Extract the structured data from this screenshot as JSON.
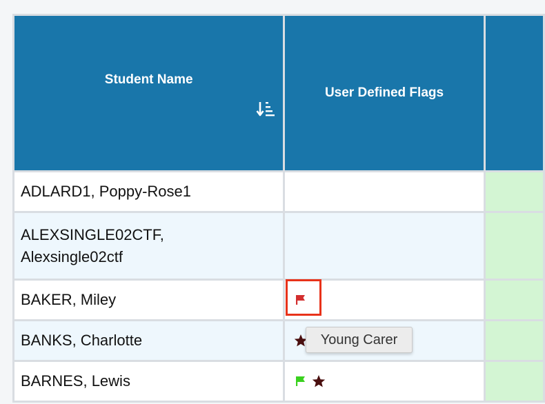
{
  "table": {
    "headers": {
      "student_name": "Student Name",
      "user_defined_flags": "User Defined Flags"
    },
    "rows": [
      {
        "name": "ADLARD1, Poppy-Rose1",
        "flags": []
      },
      {
        "name_line1": "ALEXSINGLE02CTF,",
        "name_line2": "Alexsingle02ctf",
        "flags": []
      },
      {
        "name": "BAKER, Miley",
        "flags": [
          {
            "icon": "flag-icon",
            "color": "#d32f2f"
          }
        ]
      },
      {
        "name": "BANKS, Charlotte",
        "flags": [
          {
            "icon": "star-icon",
            "color": "#4a0f0f"
          }
        ]
      },
      {
        "name": "BARNES, Lewis",
        "flags": [
          {
            "icon": "flag-icon",
            "color": "#3ad11f"
          },
          {
            "icon": "star-icon",
            "color": "#4a0f0f"
          }
        ]
      }
    ]
  },
  "tooltip": {
    "text": "Young Carer"
  },
  "colors": {
    "header_bg": "#1976aa",
    "next_column_bg": "#d3f5d3",
    "highlight_border": "#e8321a"
  }
}
